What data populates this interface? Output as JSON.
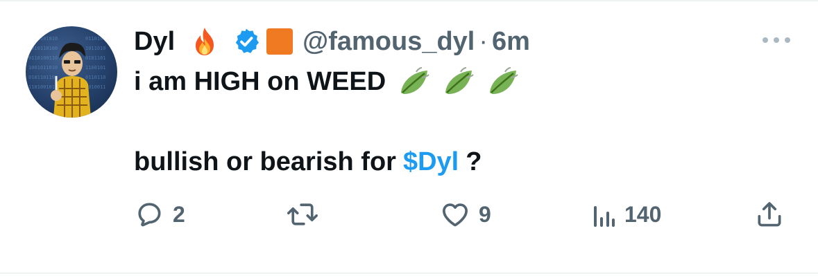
{
  "tweet": {
    "display_name": "Dyl",
    "handle": "@famous_dyl",
    "separator": "·",
    "time": "6m",
    "text_line1": "i am HIGH on WEED",
    "text_line2_prefix": "bullish or bearish for",
    "cashtag": "$Dyl",
    "text_line2_suffix": "?",
    "emojis": [
      "fire-emoji",
      "leaf-emoji"
    ],
    "colors": {
      "text": "#0f1419",
      "secondary": "#536471",
      "link": "#1d9bf0",
      "verified": "#1d9bf0",
      "square_badge": "#f07a22"
    }
  },
  "actions": {
    "reply_count": "2",
    "like_count": "9",
    "views_count": "140"
  }
}
